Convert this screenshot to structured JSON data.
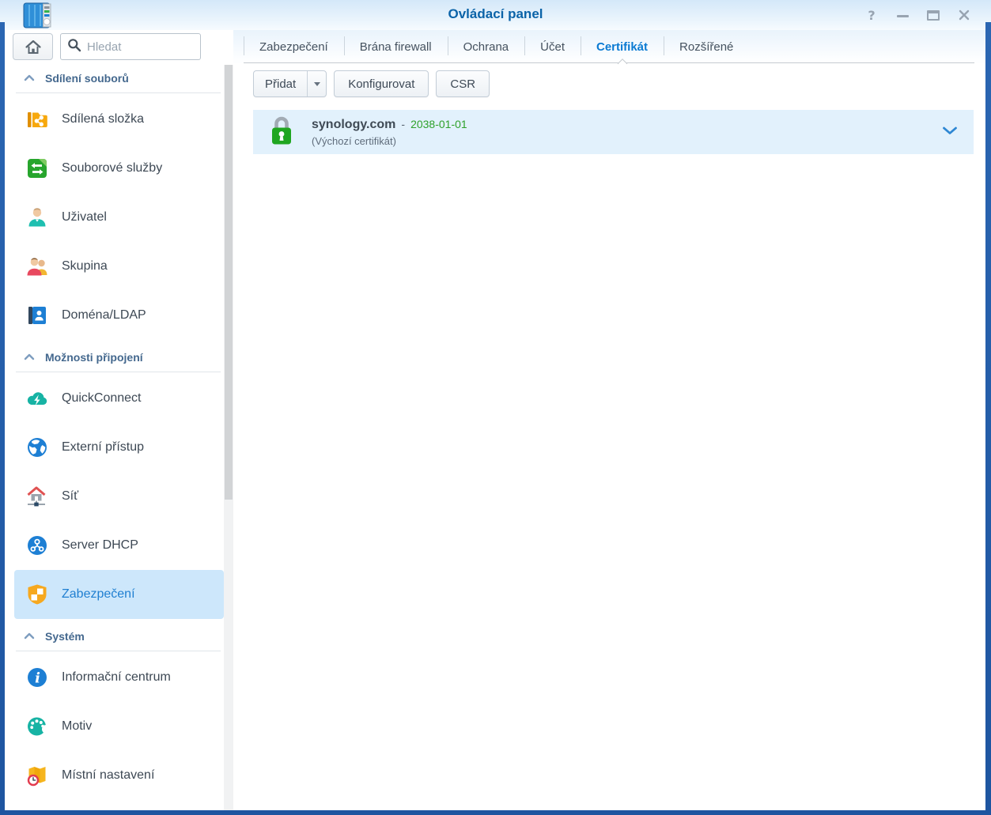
{
  "window": {
    "title": "Ovládací panel"
  },
  "titlebar_icons": {
    "help": "?",
    "close": "✕"
  },
  "sidebar": {
    "search_placeholder": "Hledat",
    "sections": [
      {
        "label": "Sdílení souborů",
        "items": [
          {
            "label": "Sdílená složka",
            "icon": "shared-folder"
          },
          {
            "label": "Souborové služby",
            "icon": "file-services"
          },
          {
            "label": "Uživatel",
            "icon": "user"
          },
          {
            "label": "Skupina",
            "icon": "group"
          },
          {
            "label": "Doména/LDAP",
            "icon": "domain-ldap"
          }
        ]
      },
      {
        "label": "Možnosti připojení",
        "items": [
          {
            "label": "QuickConnect",
            "icon": "quickconnect-cloud"
          },
          {
            "label": "Externí přístup",
            "icon": "globe"
          },
          {
            "label": "Síť",
            "icon": "network-house"
          },
          {
            "label": "Server DHCP",
            "icon": "dhcp-server"
          },
          {
            "label": "Zabezpečení",
            "icon": "security-shield",
            "selected": true
          }
        ]
      },
      {
        "label": "Systém",
        "items": [
          {
            "label": "Informační centrum",
            "icon": "info-circle"
          },
          {
            "label": "Motiv",
            "icon": "theme-palette"
          },
          {
            "label": "Místní nastavení",
            "icon": "regional-map-clock"
          }
        ]
      }
    ]
  },
  "tabs": [
    {
      "label": "Zabezpečení",
      "active": false
    },
    {
      "label": "Brána firewall",
      "active": false
    },
    {
      "label": "Ochrana",
      "active": false
    },
    {
      "label": "Účet",
      "active": false
    },
    {
      "label": "Certifikát",
      "active": true
    },
    {
      "label": "Rozšířené",
      "active": false
    }
  ],
  "toolbar": {
    "add_label": "Přidat",
    "configure_label": "Konfigurovat",
    "csr_label": "CSR"
  },
  "certificates": [
    {
      "name": "synology.com",
      "dash": "-",
      "valid_until": "2038-01-01",
      "note": "(Výchozí certifikát)"
    }
  ],
  "colors": {
    "accent_blue": "#0a7ad2",
    "title_blue": "#0b63a8",
    "cert_green": "#2fa12b",
    "cert_row_bg": "#e2f1fc",
    "selected_item_bg": "#cde7fb",
    "frame_blue": "#2a63ae"
  }
}
